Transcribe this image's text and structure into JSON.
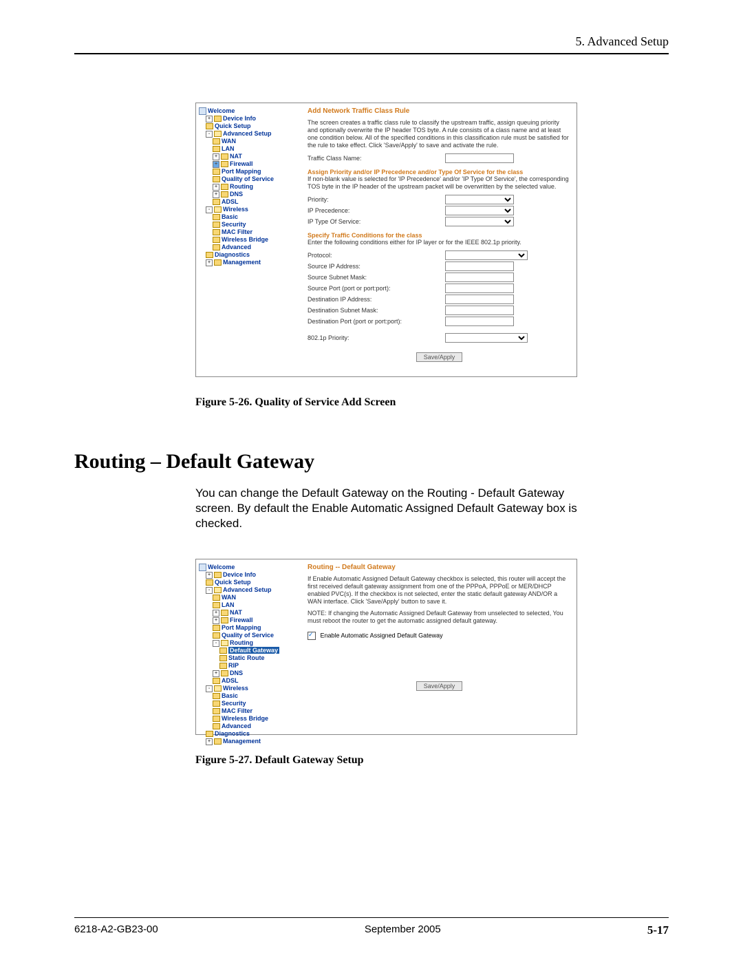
{
  "header": {
    "chapter": "5. Advanced Setup"
  },
  "figure1": {
    "caption": "Figure 5-26.   Quality of Service Add Screen",
    "nav": {
      "welcome": "Welcome",
      "deviceInfo": "Device Info",
      "quickSetup": "Quick Setup",
      "advancedSetup": "Advanced Setup",
      "wan": "WAN",
      "lan": "LAN",
      "nat": "NAT",
      "firewall": "Firewall",
      "portMapping": "Port Mapping",
      "qos": "Quality of Service",
      "routing": "Routing",
      "dns": "DNS",
      "adsl": "ADSL",
      "wireless": "Wireless",
      "basic": "Basic",
      "security": "Security",
      "macFilter": "MAC Filter",
      "wirelessBridge": "Wireless Bridge",
      "advanced": "Advanced",
      "diagnostics": "Diagnostics",
      "management": "Management"
    },
    "content": {
      "title": "Add Network Traffic Class Rule",
      "intro": "The screen creates a traffic class rule to classify the upstream traffic, assign queuing priority and optionally overwrite the IP header TOS byte. A rule consists of a class name and at least one condition below. All of the specified conditions in this classification rule must be satisfied for the rule to take effect. Click 'Save/Apply' to save and activate the rule.",
      "trafficClassName": "Traffic Class Name:",
      "assignHeading": "Assign Priority and/or IP Precedence and/or Type Of Service for the class",
      "assignNote": "If non-blank value is selected for 'IP Precedence' and/or 'IP Type Of Service', the corresponding TOS byte in the IP header of the upstream packet will be overwritten by the selected value.",
      "priority": "Priority:",
      "ipPrecedence": "IP Precedence:",
      "ipTos": "IP Type Of Service:",
      "specifyHeading": "Specify Traffic Conditions for the class",
      "specifyNote": "Enter the following conditions either for IP layer or for the IEEE 802.1p priority.",
      "protocol": "Protocol:",
      "srcIp": "Source IP Address:",
      "srcMask": "Source Subnet Mask:",
      "srcPort": "Source Port (port or port:port):",
      "dstIp": "Destination IP Address:",
      "dstMask": "Destination Subnet Mask:",
      "dstPort": "Destination Port (port or port:port):",
      "p8021": "802.1p Priority:",
      "saveApply": "Save/Apply"
    }
  },
  "section": {
    "heading": "Routing – Default Gateway",
    "body": "You can change the Default Gateway on the Routing - Default Gateway screen. By default the Enable Automatic Assigned Default Gateway box is checked."
  },
  "figure2": {
    "caption": "Figure 5-27.   Default Gateway Setup",
    "nav": {
      "welcome": "Welcome",
      "deviceInfo": "Device Info",
      "quickSetup": "Quick Setup",
      "advancedSetup": "Advanced Setup",
      "wan": "WAN",
      "lan": "LAN",
      "nat": "NAT",
      "firewall": "Firewall",
      "portMapping": "Port Mapping",
      "qos": "Quality of Service",
      "routing": "Routing",
      "defaultGateway": "Default Gateway",
      "staticRoute": "Static Route",
      "rip": "RIP",
      "dns": "DNS",
      "adsl": "ADSL",
      "wireless": "Wireless",
      "basic": "Basic",
      "security": "Security",
      "macFilter": "MAC Filter",
      "wirelessBridge": "Wireless Bridge",
      "advanced": "Advanced",
      "diagnostics": "Diagnostics",
      "management": "Management"
    },
    "content": {
      "title": "Routing -- Default Gateway",
      "p1": "If Enable Automatic Assigned Default Gateway checkbox is selected, this router will accept the first received default gateway assignment from one of the PPPoA, PPPoE or MER/DHCP enabled PVC(s). If the checkbox is not selected, enter the static default gateway AND/OR a WAN interface. Click 'Save/Apply' button to save it.",
      "note": "NOTE: If changing the Automatic Assigned Default Gateway from unselected to selected, You must reboot the router to get the automatic assigned default gateway.",
      "checkboxLabel": "Enable Automatic Assigned Default Gateway",
      "saveApply": "Save/Apply"
    }
  },
  "footer": {
    "doc": "6218-A2-GB23-00",
    "date": "September 2005",
    "page": "5-17"
  }
}
